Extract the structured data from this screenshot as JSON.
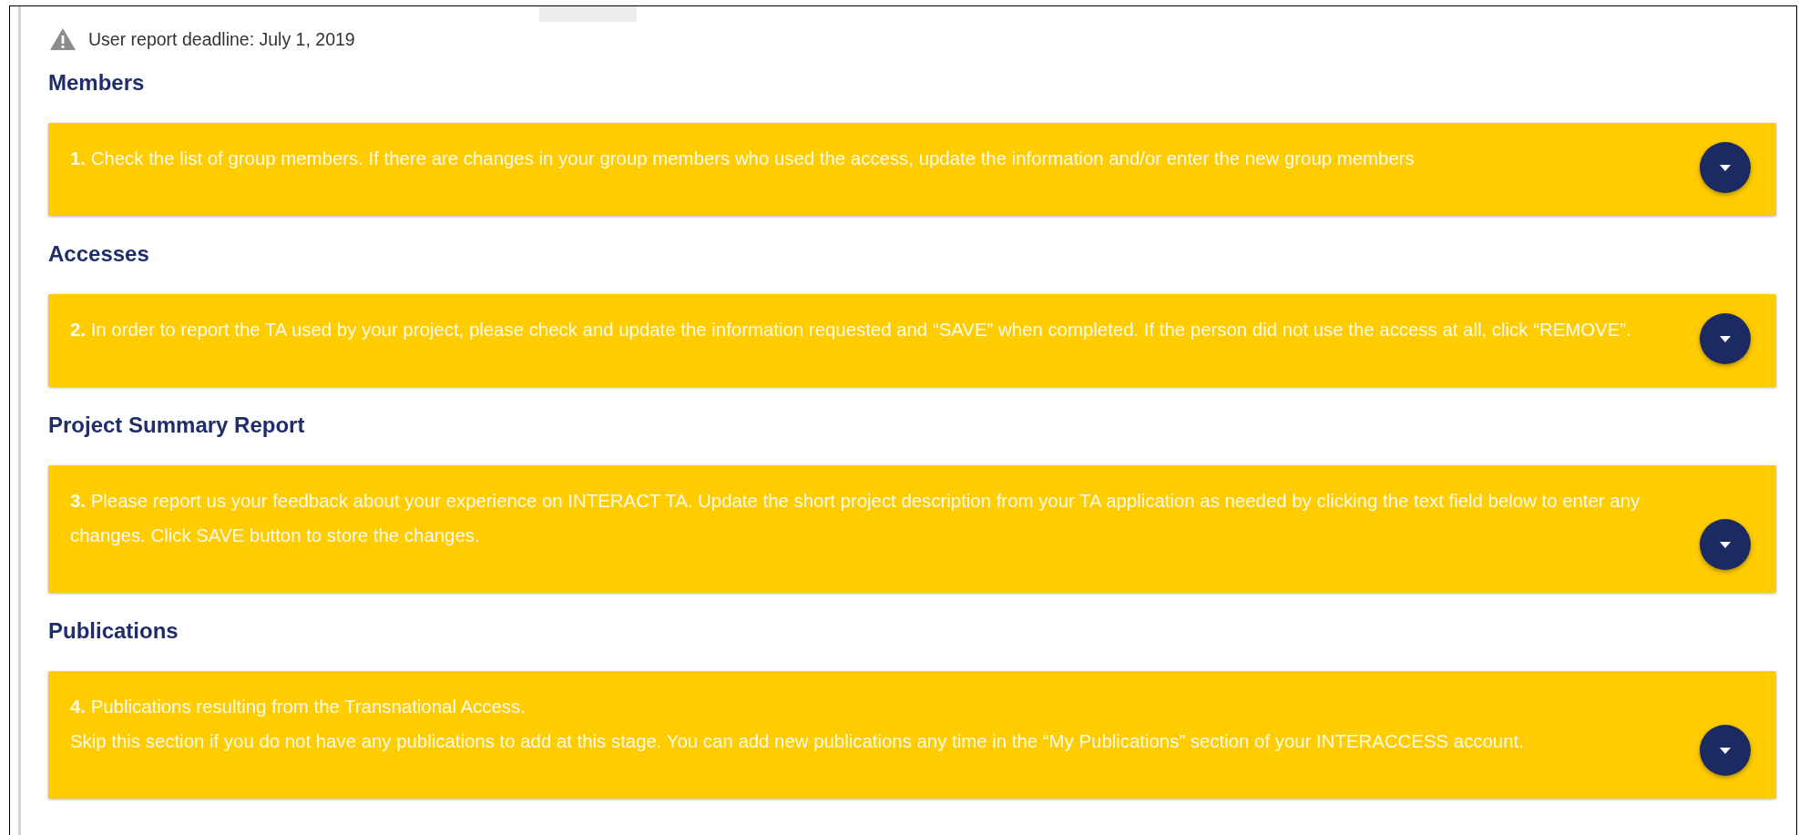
{
  "notice": {
    "text": "User report deadline: July 1, 2019"
  },
  "sections": [
    {
      "heading": "Members",
      "lines": [
        "**1.**  Check the list of group members. If there are changes in your group members who used the access, update the information and/or enter the new group members"
      ],
      "expanded": false
    },
    {
      "heading": "Accesses",
      "lines": [
        "**2.**  In order to report the TA used by your project, please check and update the information requested and “SAVE” when completed. If the person did not use the access at all, click “REMOVE”."
      ],
      "expanded": false
    },
    {
      "heading": "Project Summary Report",
      "lines": [
        "**3.**  Please report us your feedback about your experience on INTERACT TA. Update the short project description from your TA application as needed by clicking the text field below to enter any changes. Click SAVE button to store the changes."
      ],
      "expanded": false
    },
    {
      "heading": "Publications",
      "lines": [
        "**4.**  Publications resulting from the Transnational Access.",
        "Skip this section if you do not have any publications to add at this stage. You can add new publications any time in the “My Publications” section of your INTERACCESS account."
      ],
      "expanded": false
    }
  ]
}
